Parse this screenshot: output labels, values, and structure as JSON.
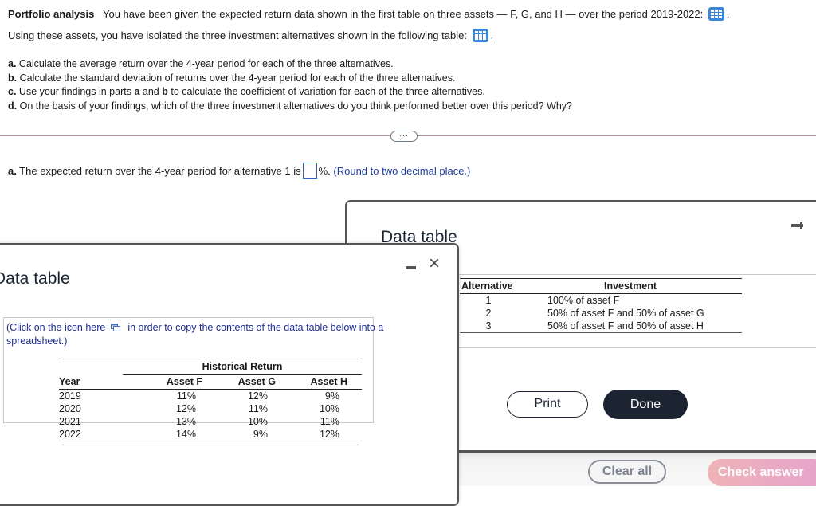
{
  "question": {
    "title": "Portfolio analysis",
    "intro_1": "You have been given the expected return data shown in the first table on three assets — F, G, and H — over the period 2019-2022:",
    "intro_2": "Using these assets, you have isolated the three investment alternatives shown in the following table:",
    "period_after_icon": ".",
    "parts": [
      {
        "label": "a.",
        "text": "Calculate the average return over the 4-year period for each of the three alternatives."
      },
      {
        "label": "b.",
        "text": "Calculate the standard deviation of returns over the 4-year period for each of the three alternatives."
      },
      {
        "label": "c.",
        "text_pre": "Use your findings in parts",
        "bold_a": "a",
        "text_mid": "and",
        "bold_b": "b",
        "text_post": "to calculate the coefficient of variation for each of the three alternatives."
      },
      {
        "label": "d.",
        "text": "On the basis of your findings, which of the three investment alternatives do you think performed better over this period?  Why?"
      }
    ],
    "more_button": "···"
  },
  "answer": {
    "label": "a.",
    "text_before": "The expected return over the 4-year period for alternative 1 is",
    "value": "",
    "text_after": "%.",
    "hint": "(Round to two decimal place.)"
  },
  "dialog_alternatives": {
    "title": "Data table",
    "headers": [
      "Alternative",
      "Investment"
    ],
    "rows": [
      {
        "alt": "1",
        "investment": "100% of asset F"
      },
      {
        "alt": "2",
        "investment": "50% of asset F and 50% of asset G"
      },
      {
        "alt": "3",
        "investment": "50% of asset F and 50% of asset H"
      }
    ],
    "print_label": "Print",
    "done_label": "Done"
  },
  "dialog_returns": {
    "title": "Data table",
    "copy_note_pre": "(Click on the icon here",
    "copy_note_post": "in order to copy the contents of the data table below into a spreadsheet.)",
    "group_header": "Historical Return",
    "headers": [
      "Year",
      "Asset F",
      "Asset G",
      "Asset H"
    ],
    "rows": [
      [
        "2019",
        "11%",
        "12%",
        "9%"
      ],
      [
        "2020",
        "12%",
        "11%",
        "10%"
      ],
      [
        "2021",
        "13%",
        "10%",
        "11%"
      ],
      [
        "2022",
        "14%",
        "9%",
        "12%"
      ]
    ],
    "close_icon": "×"
  },
  "footer": {
    "clear_label": "Clear all",
    "check_label": "Check answer"
  },
  "colors": {
    "accent_blue": "#3a86d8",
    "hint_blue": "#1d3c9e",
    "done_dark": "#1c2331",
    "check_pink": "#e6a3cc"
  }
}
